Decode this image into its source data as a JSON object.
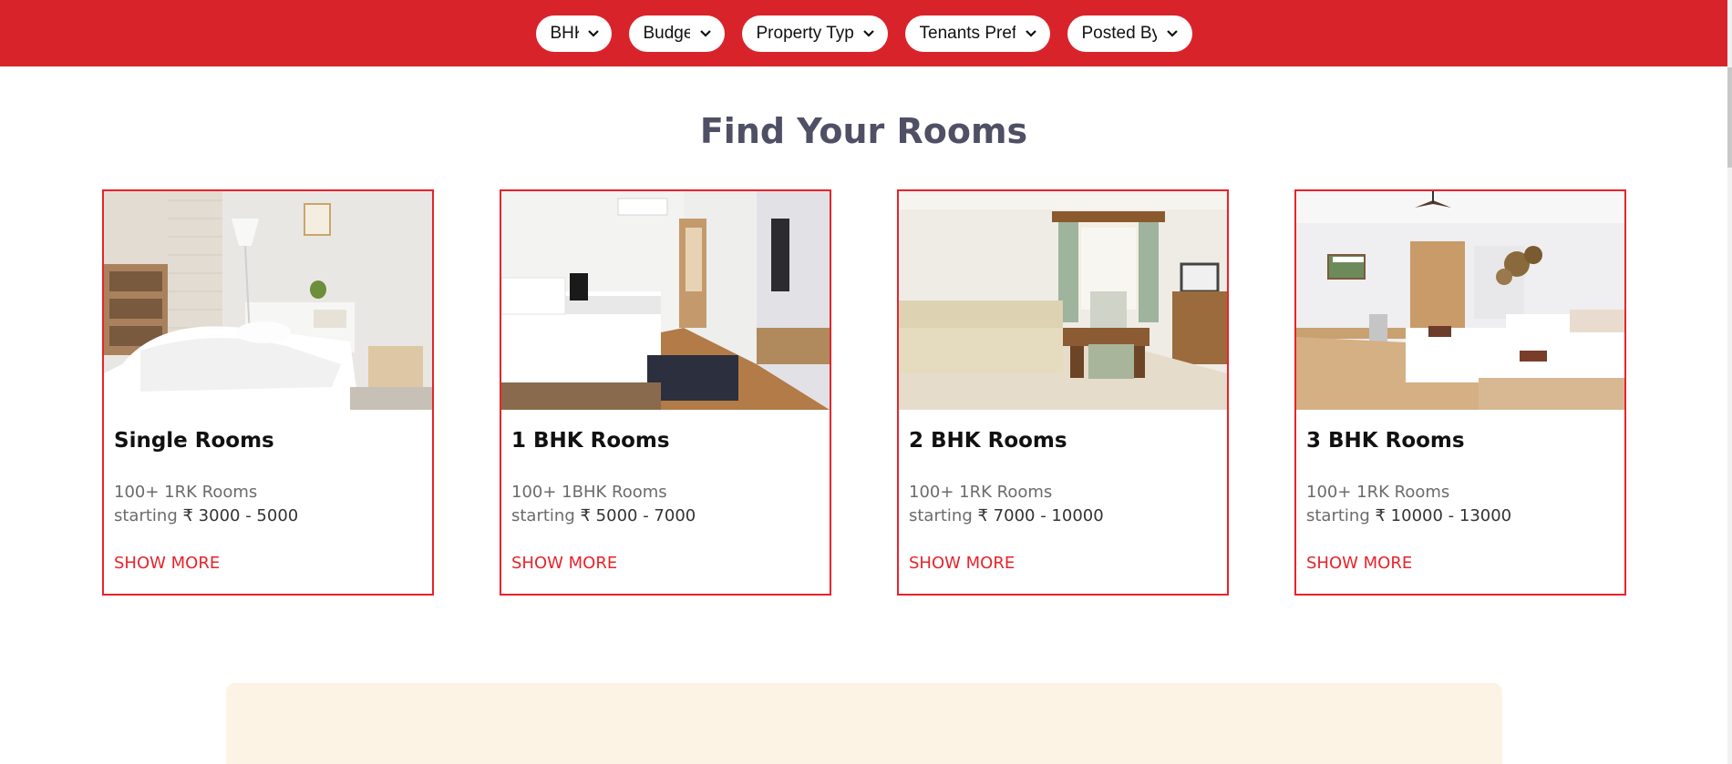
{
  "filters": [
    {
      "label": "BHK",
      "icon": "chevron-down-icon"
    },
    {
      "label": "Budget",
      "icon": "chevron-down-icon"
    },
    {
      "label": "Property Type",
      "icon": "chevron-down-icon"
    },
    {
      "label": "Tenants Prefa",
      "icon": "chevron-down-icon"
    },
    {
      "label": "Posted By",
      "icon": "chevron-down-icon"
    }
  ],
  "section": {
    "title": "Find Your Rooms"
  },
  "cards": [
    {
      "title": "Single Rooms",
      "count": "100+ 1RK Rooms",
      "starting": "starting",
      "price": "₹ 3000 - 5000",
      "cta": "SHOW MORE"
    },
    {
      "title": "1 BHK Rooms",
      "count": "100+ 1BHK Rooms",
      "starting": "starting",
      "price": "₹ 5000 - 7000",
      "cta": "SHOW MORE"
    },
    {
      "title": "2 BHK Rooms",
      "count": "100+ 1RK Rooms",
      "starting": "starting",
      "price": "₹ 7000 - 10000",
      "cta": "SHOW MORE"
    },
    {
      "title": "3 BHK Rooms",
      "count": "100+ 1RK Rooms",
      "starting": "starting",
      "price": "₹ 10000 - 13000",
      "cta": "SHOW MORE"
    }
  ],
  "colors": {
    "brand": "#d9232b",
    "heading": "#4f4f66",
    "card_border": "#e8232b",
    "promo_bg": "#fdf3e5"
  }
}
